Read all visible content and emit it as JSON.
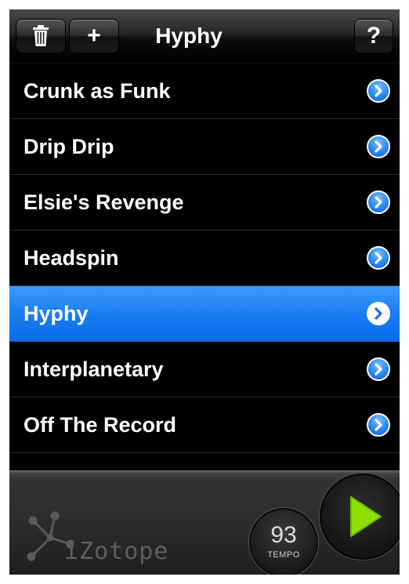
{
  "header": {
    "title": "Hyphy",
    "add_label": "+",
    "help_label": "?",
    "delete_icon": "trash-icon"
  },
  "songs": [
    {
      "label": "Crunk as Funk",
      "selected": false
    },
    {
      "label": "Drip Drip",
      "selected": false
    },
    {
      "label": "Elsie's Revenge",
      "selected": false
    },
    {
      "label": "Headspin",
      "selected": false
    },
    {
      "label": "Hyphy",
      "selected": true
    },
    {
      "label": "Interplanetary",
      "selected": false
    },
    {
      "label": "Off The Record",
      "selected": false
    }
  ],
  "footer": {
    "brand": "iZotope",
    "tempo_value": "93",
    "tempo_label": "TEMPO",
    "play_icon": "play-icon"
  },
  "colors": {
    "selection": "#1a7ef2",
    "play_accent": "#8ee000",
    "disclosure": "#2b86f0"
  }
}
